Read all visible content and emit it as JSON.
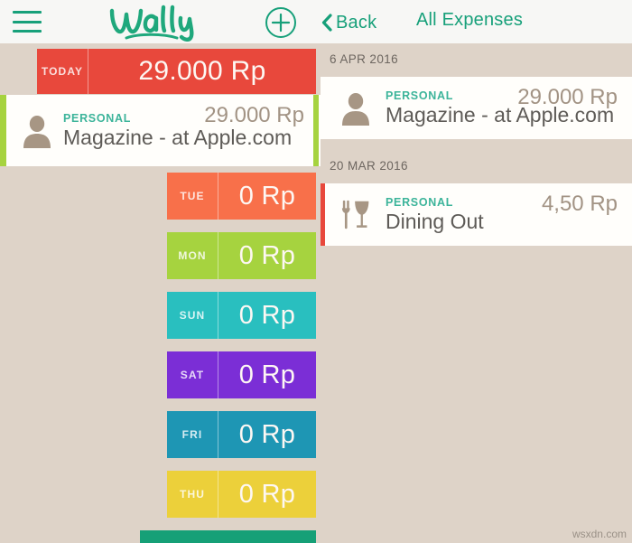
{
  "app": {
    "logo_text": "Wally",
    "background_color": "#ded3c8",
    "brand_color": "#17a07a"
  },
  "topbar": {
    "menu_icon": "hamburger-icon",
    "add_icon": "plus-circle-icon",
    "back_icon": "chevron-left-icon",
    "back_label": "Back",
    "title": "All Expenses"
  },
  "calendar": {
    "today": {
      "label": "TODAY",
      "amount": "29.000 Rp",
      "color": "#e8483c"
    },
    "featured_expense": {
      "category": "PERSONAL",
      "name": "Magazine - at Apple.com",
      "amount": "29.000 Rp",
      "accent_color": "#a6d33f",
      "icon": "person-icon"
    },
    "days": [
      {
        "label": "TUE",
        "amount": "0 Rp",
        "color": "#f8704a"
      },
      {
        "label": "MON",
        "amount": "0 Rp",
        "color": "#a6d33f"
      },
      {
        "label": "SUN",
        "amount": "0 Rp",
        "color": "#29bfbf"
      },
      {
        "label": "SAT",
        "amount": "0 Rp",
        "color": "#7b2ed6"
      },
      {
        "label": "FRI",
        "amount": "0 Rp",
        "color": "#1e96b4"
      },
      {
        "label": "THU",
        "amount": "0 Rp",
        "color": "#ecd03a"
      },
      {
        "label": "",
        "amount": "",
        "color": "#16a077"
      }
    ]
  },
  "expenses": {
    "groups": [
      {
        "date": "6 APR 2016",
        "items": [
          {
            "category": "PERSONAL",
            "name": "Magazine - at Apple.com",
            "amount": "29.000 Rp",
            "icon": "person-icon",
            "accent_color": "#fffefb"
          }
        ]
      },
      {
        "date": "20 MAR 2016",
        "items": [
          {
            "category": "PERSONAL",
            "name": "Dining Out",
            "amount": "4,50 Rp",
            "icon": "fork-wineglass-icon",
            "accent_color": "#e8483c"
          }
        ]
      }
    ]
  },
  "watermark": "wsxdn.com"
}
